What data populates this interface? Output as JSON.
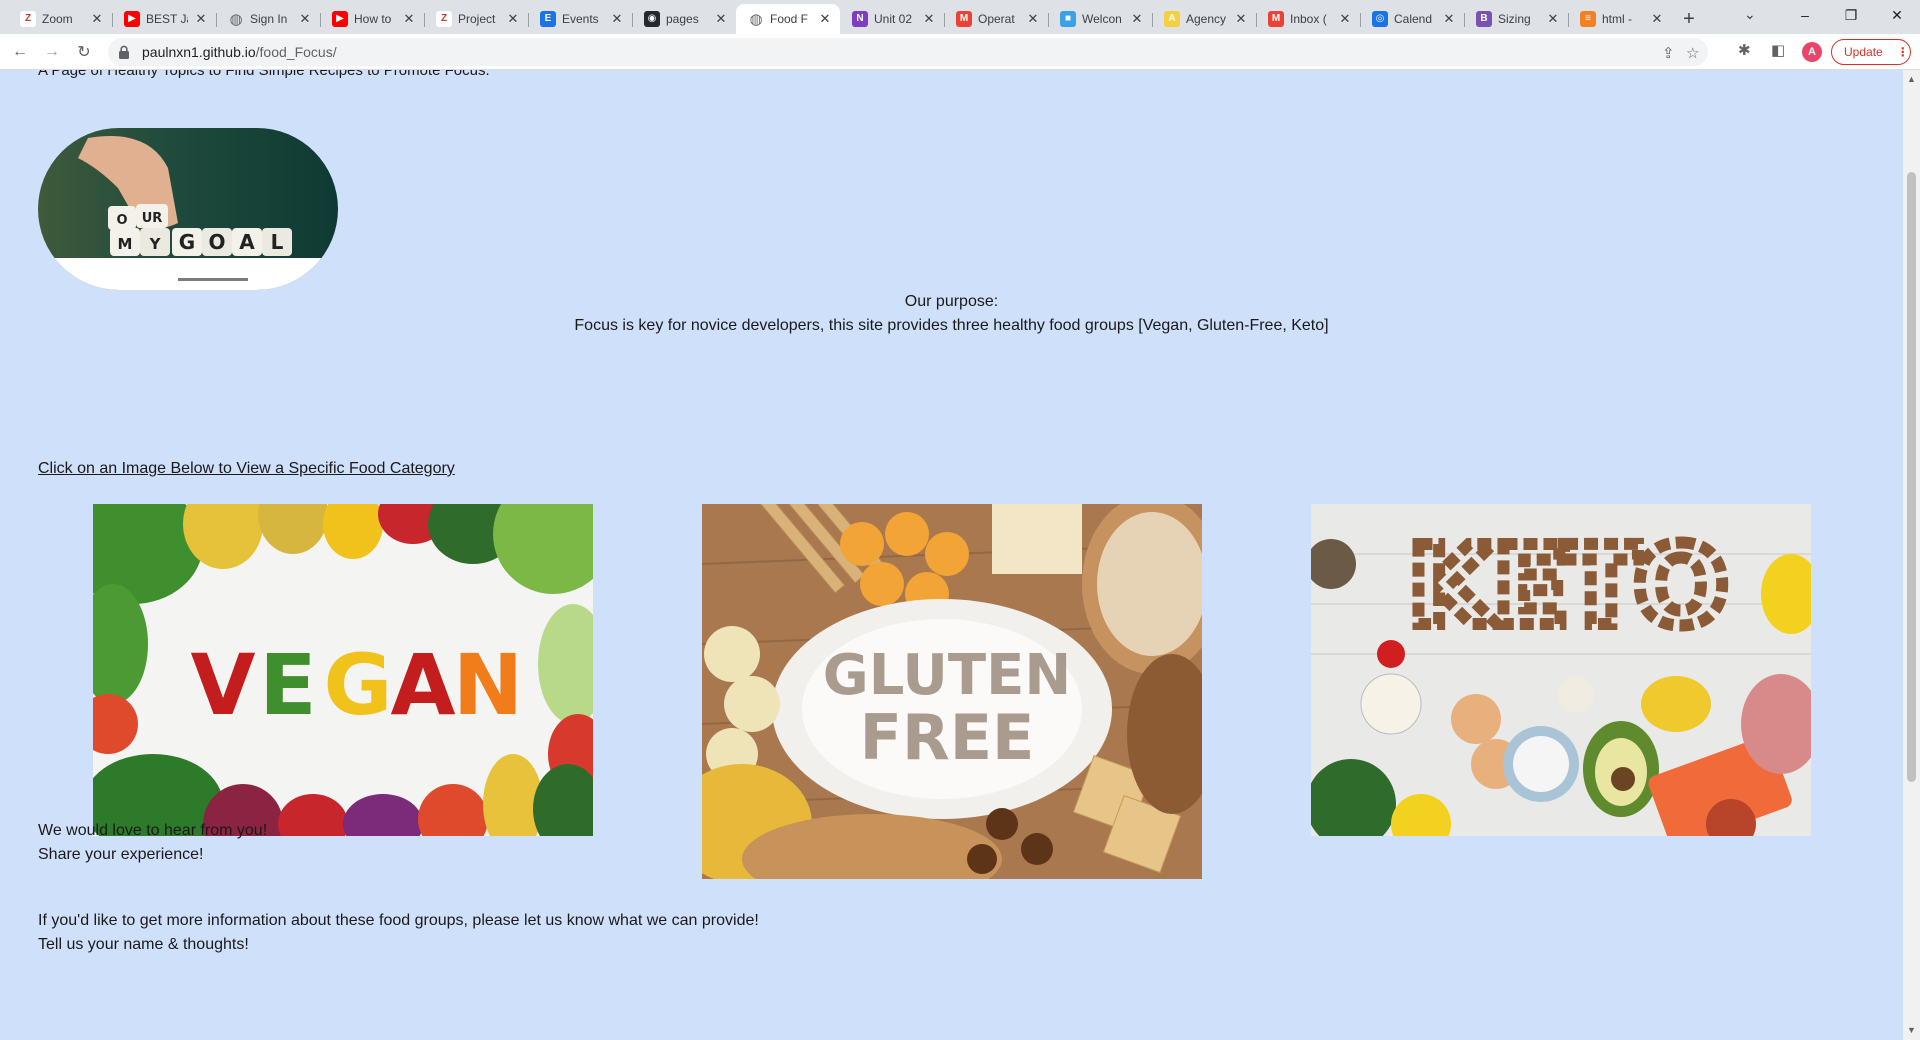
{
  "tabs": [
    {
      "title": "Zoom",
      "favicon": "zoom-logo-icon",
      "color": "#ffffff"
    },
    {
      "title": "BEST Ja",
      "favicon": "youtube-icon",
      "color": "#ff0000"
    },
    {
      "title": "Sign In",
      "favicon": "globe-icon",
      "color": "#5f6368"
    },
    {
      "title": "How to",
      "favicon": "youtube-icon",
      "color": "#ff0000"
    },
    {
      "title": "Project",
      "favicon": "zoom-logo-icon",
      "color": "#ffffff"
    },
    {
      "title": "Events",
      "favicon": "events-icon",
      "color": "#1a73e8"
    },
    {
      "title": "pages",
      "favicon": "github-icon",
      "color": "#24292f"
    },
    {
      "title": "Food F",
      "favicon": "globe-icon",
      "color": "#5f6368",
      "active": true
    },
    {
      "title": "Unit 02",
      "favicon": "onenote-icon",
      "color": "#7b3fbf"
    },
    {
      "title": "Operat",
      "favicon": "gmail-icon",
      "color": "#ea4335"
    },
    {
      "title": "Welcon",
      "favicon": "site-icon",
      "color": "#3aa0e8"
    },
    {
      "title": "Agency",
      "favicon": "agency-icon",
      "color": "#f4d03f"
    },
    {
      "title": "Inbox (",
      "favicon": "gmail-icon",
      "color": "#ea4335"
    },
    {
      "title": "Calend",
      "favicon": "calendar-icon",
      "color": "#1a73e8"
    },
    {
      "title": "Sizing",
      "favicon": "bootstrap-icon",
      "color": "#7952b3"
    },
    {
      "title": "html -",
      "favicon": "stackoverflow-icon",
      "color": "#f48024"
    }
  ],
  "toolbar": {
    "url_host": "paulnxn1.github.io",
    "url_path": "/food_Focus/",
    "avatar_letter": "A",
    "update_label": "Update"
  },
  "page": {
    "subtitle": "A Page of Healthy Topics to Find Simple Recipes to Promote Focus.",
    "goal_image_text": [
      "OUR",
      "MY",
      "GOAL"
    ],
    "purpose_heading": "Our purpose:",
    "purpose_text": "Focus is key for novice developers, this site provides three healthy food groups [Vegan, Gluten-Free, Keto]",
    "category_link": "Click on an Image Below to View a Specific Food Category",
    "categories": [
      {
        "label": "VEGAN",
        "name": "vegan-image"
      },
      {
        "label_line1": "GLUTEN",
        "label_line2": "FREE",
        "name": "gluten-free-image"
      },
      {
        "label": "KETO",
        "name": "keto-image"
      }
    ],
    "feedback_line1": "We would love to hear from you!",
    "feedback_line2": "Share your experience!",
    "info_line1": "If you'd like to get more information about these food groups, please let us know what we can provide!",
    "info_line2": "Tell us your name & thoughts!"
  }
}
